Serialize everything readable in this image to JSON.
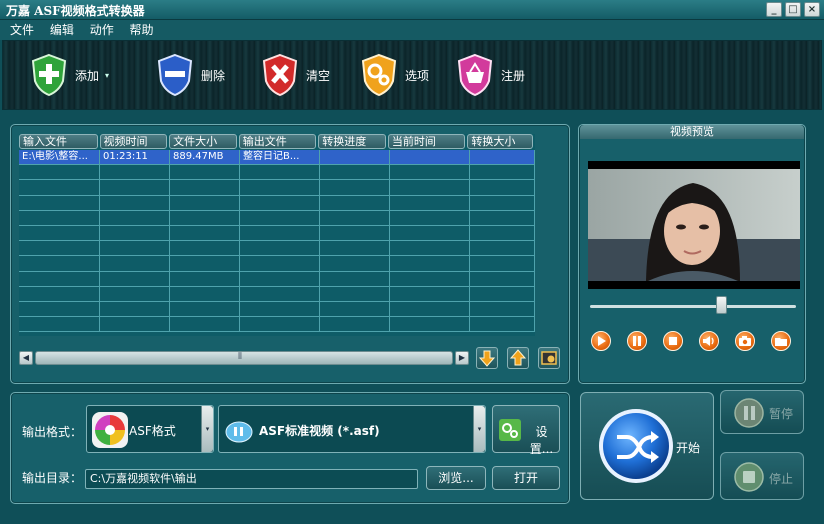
{
  "window": {
    "title": "万嘉 ASF视频格式转换器",
    "controls": [
      "_",
      "□",
      "×"
    ]
  },
  "menu": [
    "文件",
    "编辑",
    "动作",
    "帮助"
  ],
  "toolbar": [
    {
      "label": "添加",
      "icon": "add-shield-icon"
    },
    {
      "label": "删除",
      "icon": "remove-shield-icon"
    },
    {
      "label": "清空",
      "icon": "clear-shield-icon"
    },
    {
      "label": "选项",
      "icon": "options-gear-shield-icon"
    },
    {
      "label": "注册",
      "icon": "register-basket-shield-icon"
    }
  ],
  "table": {
    "columns": [
      "输入文件",
      "视频时间",
      "文件大小",
      "输出文件",
      "转换进度",
      "当前时间",
      "转换大小"
    ],
    "rows": [
      [
        "E:\\电影\\整容...",
        "01:23:11",
        "889.47MB",
        "整容日记B...",
        "",
        "",
        ""
      ]
    ]
  },
  "preview": {
    "title": "视频预览"
  },
  "output": {
    "format_label": "输出格式：",
    "format_value": "ASF格式",
    "profile_value": "ASF标准视频 (*.asf)",
    "settings_label": "设置...",
    "dir_label": "输出目录：",
    "dir_value": "C:\\万嘉视频软件\\输出",
    "browse_label": "浏览...",
    "open_label": "打开"
  },
  "actions": {
    "start_label": "开始",
    "pause_label": "暂停",
    "stop_label": "停止"
  },
  "colors": {
    "background": "#0f4f58",
    "selection": "#2f63c9",
    "accent": "#e8690e"
  }
}
